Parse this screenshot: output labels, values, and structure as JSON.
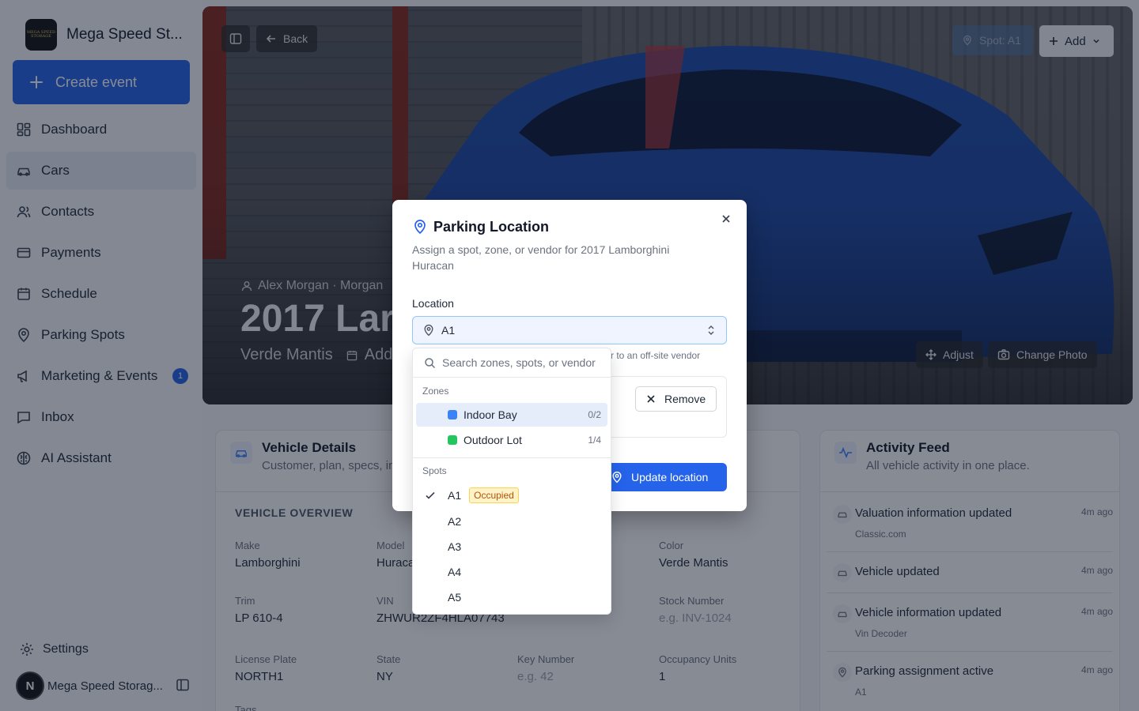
{
  "brand": {
    "name": "Mega Speed St...",
    "logo_text": "MEGA SPEED STORAGE"
  },
  "create_event": "Create event",
  "nav": [
    {
      "label": "Dashboard",
      "icon": "dashboard-icon"
    },
    {
      "label": "Cars",
      "icon": "car-icon"
    },
    {
      "label": "Contacts",
      "icon": "contacts-icon"
    },
    {
      "label": "Payments",
      "icon": "card-icon"
    },
    {
      "label": "Schedule",
      "icon": "calendar-icon"
    },
    {
      "label": "Parking Spots",
      "icon": "pin-icon"
    },
    {
      "label": "Marketing & Events",
      "icon": "megaphone-icon",
      "badge": "1"
    },
    {
      "label": "Inbox",
      "icon": "inbox-icon"
    },
    {
      "label": "AI Assistant",
      "icon": "brain-icon"
    }
  ],
  "settings": "Settings",
  "account": {
    "initial": "N",
    "name": "Mega Speed Storag..."
  },
  "hero": {
    "back": "Back",
    "spot": "Spot: A1",
    "add": "Add",
    "owner": "Alex Morgan · Morgan",
    "title": "2017 Lar",
    "color": "Verde Mantis",
    "add_date": "Add",
    "adjust": "Adjust",
    "change_photo": "Change Photo"
  },
  "vehicle_details": {
    "title": "Vehicle Details",
    "subtitle": "Customer, plan, specs, ins",
    "overview": "VEHICLE OVERVIEW",
    "fields": [
      {
        "k": "Make",
        "v": "Lamborghini"
      },
      {
        "k": "Model",
        "v": "Huraca"
      },
      {
        "k": "Color",
        "v": "Verde Mantis"
      },
      {
        "k": "Trim",
        "v": "LP 610-4"
      },
      {
        "k": "VIN",
        "v": "ZHWUR2ZF4HLA07743"
      },
      {
        "k": "Stock Number",
        "v": "e.g. INV-1024"
      },
      {
        "k": "License Plate",
        "v": "NORTH1"
      },
      {
        "k": "State",
        "v": "NY"
      },
      {
        "k": "Key Number",
        "v": "e.g. 42"
      },
      {
        "k": "Occupancy Units",
        "v": "1"
      },
      {
        "k": "Tags",
        "v": ""
      }
    ]
  },
  "activity": {
    "title": "Activity Feed",
    "subtitle": "All vehicle activity in one place.",
    "items": [
      {
        "title": "Valuation information updated",
        "sub": "Classic.com",
        "time": "4m ago"
      },
      {
        "title": "Vehicle updated",
        "sub": "",
        "time": "4m ago"
      },
      {
        "title": "Vehicle information updated",
        "sub": "Vin Decoder",
        "time": "4m ago"
      },
      {
        "title": "Parking assignment active",
        "sub": "A1",
        "time": "4m ago"
      }
    ]
  },
  "modal": {
    "title": "Parking Location",
    "description": "Assign a spot, zone, or vendor for 2017 Lamborghini Huracan",
    "location_label": "Location",
    "selected": "A1",
    "vendor_hint": "r to an off-site vendor",
    "remove": "Remove",
    "update": "Update location"
  },
  "dropdown": {
    "search_placeholder": "Search zones, spots, or vendor",
    "zones_label": "Zones",
    "zones": [
      {
        "name": "Indoor Bay",
        "count": "0/2",
        "color": "#3b82f6"
      },
      {
        "name": "Outdoor Lot",
        "count": "1/4",
        "color": "#22c55e"
      }
    ],
    "spots_label": "Spots",
    "spots": [
      {
        "name": "A1",
        "status": "Occupied",
        "selected": true
      },
      {
        "name": "A2"
      },
      {
        "name": "A3"
      },
      {
        "name": "A4"
      },
      {
        "name": "A5"
      }
    ]
  }
}
